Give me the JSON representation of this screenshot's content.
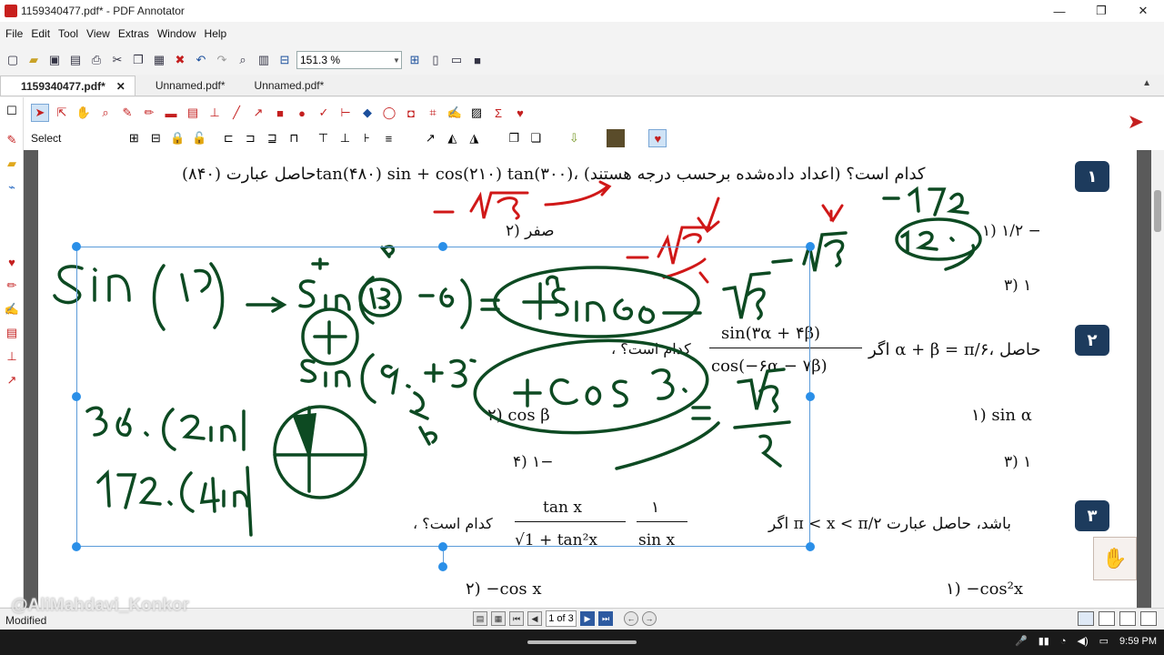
{
  "window": {
    "title": "1159340477.pdf* - PDF Annotator",
    "minimize": "—",
    "maximize": "❐",
    "close": "✕"
  },
  "menu": [
    "File",
    "Edit",
    "Tool",
    "View",
    "Extras",
    "Window",
    "Help"
  ],
  "toolbar": {
    "zoom_value": "151.3 %"
  },
  "tabs": [
    {
      "label": "1159340477.pdf*",
      "active": true,
      "close": "✕"
    },
    {
      "label": "Unnamed.pdf*",
      "active": false
    },
    {
      "label": "Unnamed.pdf*",
      "active": false
    }
  ],
  "annotate": {
    "select_label": "Select"
  },
  "document": {
    "q1": {
      "number": "۱",
      "stem": "حاصل عبارت (۸۴۰)tan(۴۸۰) sin + cos(۲۱۰) tan(۳۰۰)، کدام است؟ (اعداد داده‌شده برحسب درجه هستند)",
      "opt1": "۱)  ۱/۲ −",
      "opt2": "۲)  صفر",
      "opt3": "۳)  ۱"
    },
    "q2": {
      "number": "۲",
      "stem": "اگر α + β = π/۶، حاصل",
      "frac_num": "sin(۳α + ۴β)",
      "frac_den": "cos(−۶α − ۷β)",
      "tail": "، کدام است؟",
      "opt1": "۱)  sin α",
      "opt2": "۲)  cos β",
      "opt3": "۳)  ۱",
      "opt4": "۴)  ۱−"
    },
    "q3": {
      "number": "۳",
      "stem": "اگر π < x < π/۲ باشد، حاصل عبارت",
      "frac_a_num": "۱",
      "frac_a_den": "sin x",
      "frac_b_num": "tan x",
      "frac_b_den": "√1 + tan²x",
      "tail": "، کدام است؟",
      "opt1": "۱)  −cos²x",
      "opt2": "۲)  −cos x"
    }
  },
  "status": {
    "modified": "Modified",
    "page_indicator": "1 of 3",
    "watermark": "@AliMahdavi_Konkor"
  },
  "taskbar": {
    "time": "9:59 PM"
  },
  "colors": {
    "ink_green": "#0d4a22",
    "ink_red": "#d01818",
    "badge": "#1d3b5d",
    "selection": "#2a8fe8"
  }
}
